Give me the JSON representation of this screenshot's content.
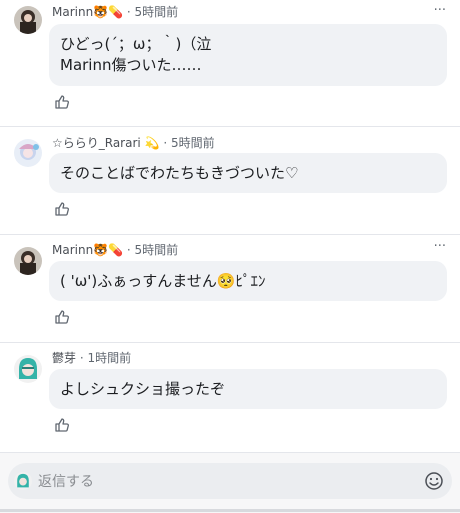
{
  "comments": [
    {
      "author": "Marinn🐯💊",
      "time": "5時間前",
      "text": "ひどっ(´；ω；｀)（泣\nMarinn傷ついた……",
      "more": "···"
    },
    {
      "author": "☆ららり_Rarari 💫",
      "time": "5時間前",
      "text": "そのことばでわたちもきづついた♡",
      "more": "···"
    },
    {
      "author": "Marinn🐯💊",
      "time": "5時間前",
      "text": "( 'ω')ふぁっすんません🥺ﾋﾟｴﾝ",
      "more": "···"
    },
    {
      "author": "鬱芽",
      "time": "1時間前",
      "text": "よしシュクショ撮ったぞ",
      "more": "···"
    }
  ],
  "reply": {
    "placeholder": "返信する"
  },
  "colors": {
    "bubble": "#f0f2f5",
    "meta": "#606770",
    "separator": "#e4e6eb"
  }
}
